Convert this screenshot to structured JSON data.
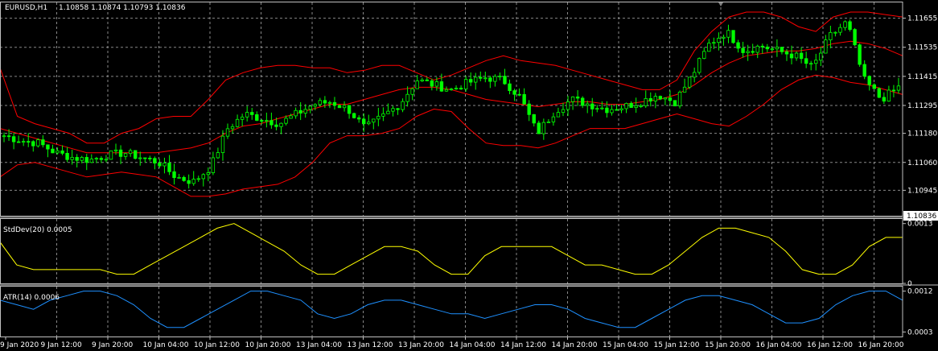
{
  "colors": {
    "background": "#000000",
    "grid": "#c0c0c0",
    "frame": "#c0c0c0",
    "candle_up": "#00ff00",
    "candle_down": "#00ff00",
    "bollinger": "#ff0000",
    "stddev": "#ffff00",
    "atr": "#1e90ff",
    "text": "#ffffff",
    "price_marker_bg": "#ffffff",
    "price_marker_text": "#000000"
  },
  "chart_data": [
    {
      "type": "candlestick",
      "title": "EURUSD,H1",
      "ohlc_header": "1.10858 1.10874 1.10793 1.10836",
      "current_price_label": "1.10836",
      "current_price": 1.10836,
      "ylim": [
        1.1084,
        1.1172
      ],
      "y_ticks": [
        "1.11655",
        "1.11535",
        "1.11415",
        "1.11295",
        "1.11180",
        "1.11060",
        "1.10945"
      ],
      "y_tick_values": [
        1.11655,
        1.11535,
        1.11415,
        1.11295,
        1.1118,
        1.1106,
        1.10945
      ],
      "x_ticks": [
        "9 Jan 2020",
        "9 Jan 12:00",
        "9 Jan 20:00",
        "10 Jan 04:00",
        "10 Jan 12:00",
        "10 Jan 20:00",
        "13 Jan 04:00",
        "13 Jan 12:00",
        "13 Jan 20:00",
        "14 Jan 04:00",
        "14 Jan 12:00",
        "14 Jan 20:00",
        "15 Jan 04:00",
        "15 Jan 12:00",
        "15 Jan 20:00",
        "16 Jan 04:00",
        "16 Jan 12:00",
        "16 Jan 20:00"
      ],
      "close_anchors": [
        1.1117,
        1.1115,
        1.1114,
        1.111,
        1.1108,
        1.1107,
        1.1109,
        1.111,
        1.1108,
        1.1106,
        1.11,
        1.1098,
        1.1104,
        1.112,
        1.1126,
        1.1124,
        1.1122,
        1.1126,
        1.113,
        1.1131,
        1.1128,
        1.112,
        1.1125,
        1.113,
        1.114,
        1.1138,
        1.1136,
        1.1139,
        1.1141,
        1.114,
        1.1133,
        1.1118,
        1.1127,
        1.1132,
        1.113,
        1.1128,
        1.1129,
        1.1131,
        1.1134,
        1.1131,
        1.1142,
        1.1155,
        1.116,
        1.1152,
        1.1154,
        1.1152,
        1.115,
        1.1145,
        1.1158,
        1.1164,
        1.114,
        1.1132,
        1.1137
      ],
      "bollinger": {
        "upper": [
          1.1145,
          1.1125,
          1.1122,
          1.112,
          1.1118,
          1.1114,
          1.1114,
          1.1118,
          1.112,
          1.1124,
          1.1125,
          1.1125,
          1.1132,
          1.114,
          1.1143,
          1.1145,
          1.1146,
          1.1146,
          1.1145,
          1.1145,
          1.1143,
          1.1144,
          1.1146,
          1.1146,
          1.1143,
          1.114,
          1.1142,
          1.1145,
          1.1148,
          1.115,
          1.1148,
          1.1147,
          1.1146,
          1.1144,
          1.1142,
          1.114,
          1.1138,
          1.1136,
          1.1136,
          1.114,
          1.1152,
          1.116,
          1.1166,
          1.1168,
          1.1168,
          1.1166,
          1.1162,
          1.116,
          1.1166,
          1.1168,
          1.1168,
          1.1167,
          1.1166
        ],
        "middle": [
          1.112,
          1.1118,
          1.1116,
          1.1114,
          1.1112,
          1.111,
          1.111,
          1.111,
          1.111,
          1.111,
          1.1111,
          1.1112,
          1.1114,
          1.1118,
          1.1121,
          1.1122,
          1.1124,
          1.1126,
          1.1128,
          1.113,
          1.113,
          1.1132,
          1.1134,
          1.1136,
          1.1137,
          1.1137,
          1.1136,
          1.1134,
          1.1132,
          1.1131,
          1.113,
          1.1129,
          1.113,
          1.1131,
          1.1131,
          1.113,
          1.113,
          1.1131,
          1.1132,
          1.1134,
          1.1138,
          1.1143,
          1.1147,
          1.115,
          1.1151,
          1.1152,
          1.1152,
          1.1153,
          1.1155,
          1.1156,
          1.1155,
          1.1153,
          1.115
        ],
        "lower": [
          1.11,
          1.1105,
          1.1106,
          1.1104,
          1.1102,
          1.11,
          1.1101,
          1.1102,
          1.1101,
          1.11,
          1.1096,
          1.1092,
          1.1092,
          1.1093,
          1.1095,
          1.1096,
          1.1097,
          1.11,
          1.1106,
          1.1114,
          1.1117,
          1.1117,
          1.1118,
          1.112,
          1.1125,
          1.1128,
          1.1127,
          1.112,
          1.1114,
          1.1113,
          1.1113,
          1.1112,
          1.1114,
          1.1117,
          1.112,
          1.112,
          1.112,
          1.1122,
          1.1124,
          1.1126,
          1.1124,
          1.1122,
          1.1121,
          1.1125,
          1.113,
          1.1136,
          1.114,
          1.1142,
          1.1141,
          1.1139,
          1.1138,
          1.1136,
          1.1134
        ]
      }
    },
    {
      "type": "line",
      "title": "StdDev(20) 0.0005",
      "ylim": [
        0,
        0.0014
      ],
      "y_ticks": [
        "0.0013",
        "0"
      ],
      "y_tick_values": [
        0.0013,
        0
      ],
      "series": [
        {
          "name": "StdDev(20)",
          "values": [
            0.0009,
            0.0004,
            0.0003,
            0.0003,
            0.0003,
            0.0003,
            0.0003,
            0.0002,
            0.0002,
            0.0004,
            0.0006,
            0.0008,
            0.001,
            0.0012,
            0.0013,
            0.0011,
            0.0009,
            0.0007,
            0.0004,
            0.0002,
            0.0002,
            0.0004,
            0.0006,
            0.0008,
            0.0008,
            0.0007,
            0.0004,
            0.0002,
            0.0002,
            0.0006,
            0.0008,
            0.0008,
            0.0008,
            0.0008,
            0.0006,
            0.0004,
            0.0004,
            0.0003,
            0.0002,
            0.0002,
            0.0004,
            0.0007,
            0.001,
            0.0012,
            0.0012,
            0.0011,
            0.001,
            0.0007,
            0.0003,
            0.0002,
            0.0002,
            0.0004,
            0.0008,
            0.001,
            0.001
          ]
        }
      ]
    },
    {
      "type": "line",
      "title": "ATR(14) 0.0006",
      "ylim": [
        0.0002,
        0.0013
      ],
      "y_ticks": [
        "0.0012",
        "0.0003"
      ],
      "y_tick_values": [
        0.0012,
        0.0003
      ],
      "series": [
        {
          "name": "ATR(14)",
          "values": [
            0.001,
            0.0009,
            0.0008,
            0.001,
            0.0011,
            0.0012,
            0.0012,
            0.0011,
            0.0009,
            0.0006,
            0.0004,
            0.0004,
            0.0006,
            0.0008,
            0.001,
            0.0012,
            0.0012,
            0.0011,
            0.001,
            0.0007,
            0.0006,
            0.0007,
            0.0009,
            0.001,
            0.001,
            0.0009,
            0.0008,
            0.0007,
            0.0007,
            0.0006,
            0.0007,
            0.0008,
            0.0009,
            0.0009,
            0.0008,
            0.0006,
            0.0005,
            0.0004,
            0.0004,
            0.0006,
            0.0008,
            0.001,
            0.0011,
            0.0011,
            0.001,
            0.0009,
            0.0007,
            0.0005,
            0.0005,
            0.0006,
            0.0009,
            0.0011,
            0.0012,
            0.0012,
            0.001
          ]
        }
      ]
    }
  ]
}
